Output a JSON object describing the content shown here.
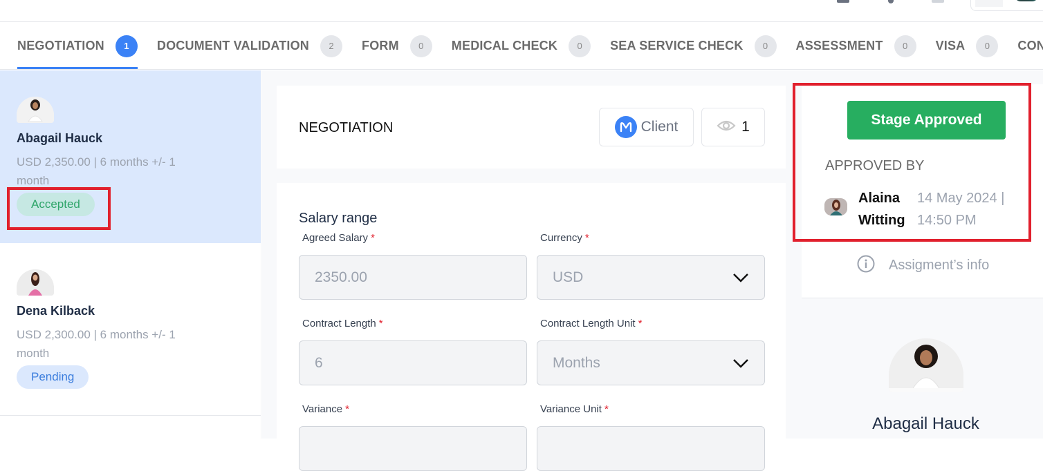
{
  "tabs": [
    {
      "label": "NEGOTIATION",
      "count": "1",
      "active": true
    },
    {
      "label": "DOCUMENT VALIDATION",
      "count": "2"
    },
    {
      "label": "FORM",
      "count": "0"
    },
    {
      "label": "MEDICAL CHECK",
      "count": "0"
    },
    {
      "label": "SEA SERVICE CHECK",
      "count": "0"
    },
    {
      "label": "ASSESSMENT",
      "count": "0"
    },
    {
      "label": "VISA",
      "count": "0"
    },
    {
      "label": "CONT",
      "count": ""
    }
  ],
  "candidates": [
    {
      "name": "Abagail Hauck",
      "meta": "USD 2,350.00  |  6 months +/- 1 month",
      "status": "Accepted",
      "selected": true
    },
    {
      "name": "Dena Kilback",
      "meta": "USD 2,300.00  |  6 months +/- 1 month",
      "status": "Pending",
      "selected": false
    }
  ],
  "stage": {
    "title": "NEGOTIATION",
    "client_label": "Client",
    "views_count": "1"
  },
  "form": {
    "section_title": "Salary range",
    "agreed_salary_label": "Agreed Salary",
    "agreed_salary_value": "2350.00",
    "currency_label": "Currency",
    "currency_value": "USD",
    "contract_length_label": "Contract Length",
    "contract_length_value": "6",
    "contract_length_unit_label": "Contract Length Unit",
    "contract_length_unit_value": "Months",
    "variance_label": "Variance",
    "variance_unit_label": "Variance Unit",
    "required_mark": "*"
  },
  "approval": {
    "button_label": "Stage Approved",
    "approved_by_label": "APPROVED BY",
    "approver_name": "Alaina Witting",
    "approved_at": "14 May 2024 | 14:50 PM",
    "info_link_label": "Assigment’s info"
  },
  "profile": {
    "name": "Abagail Hauck"
  },
  "colors": {
    "accent": "#3b82f6",
    "approved_green": "#27ae60",
    "accepted_text": "#2fa56a",
    "pending_text": "#3b7ddd",
    "highlight_red": "#e1202d"
  }
}
